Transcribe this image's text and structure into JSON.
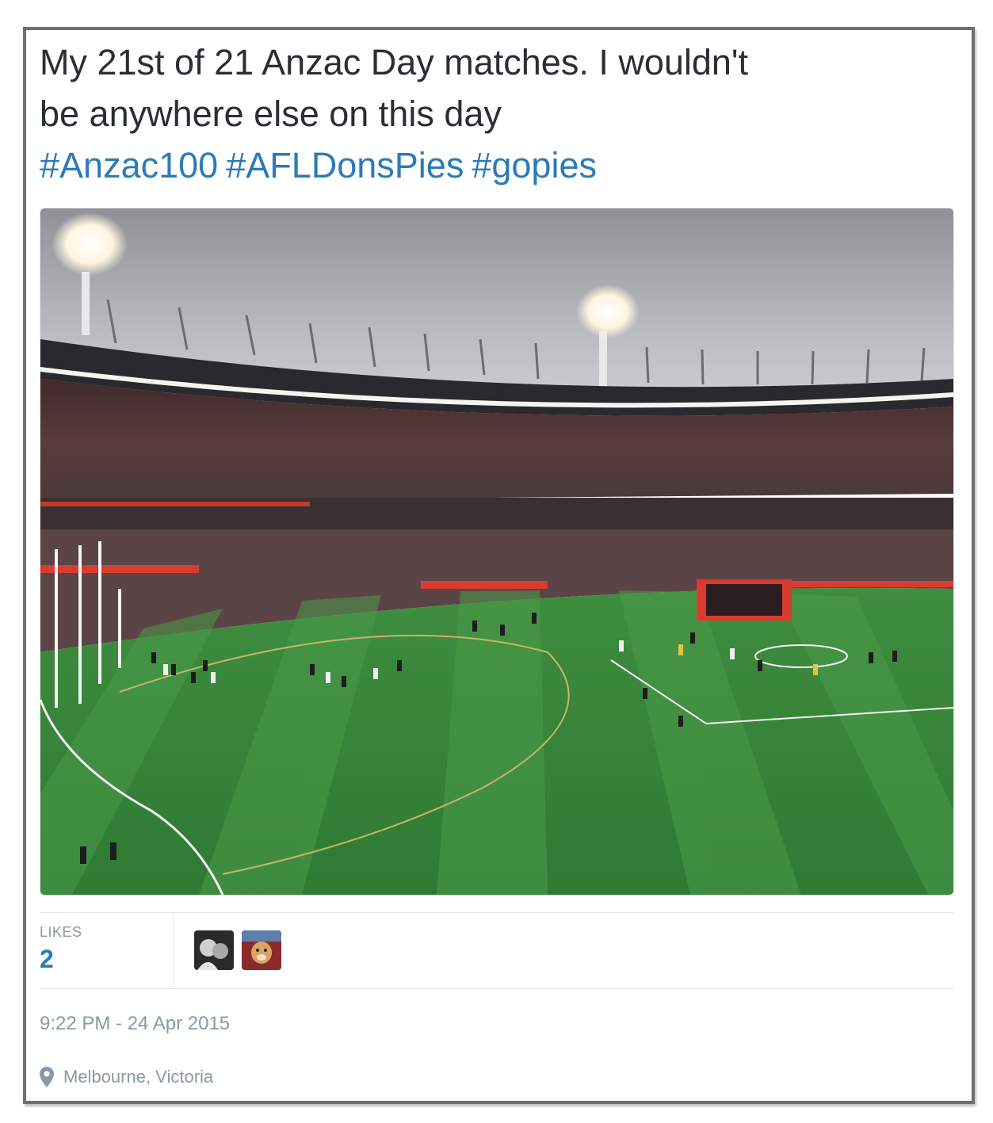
{
  "tweet": {
    "text_line1": "My 21st of 21 Anzac Day matches. I wouldn't",
    "text_line2": "be anywhere else on this day",
    "hashtags": [
      "#Anzac100",
      "#AFLDonsPies",
      "#gopies"
    ]
  },
  "photo": {
    "description_icon": "stadium-photo"
  },
  "stats": {
    "likes_label": "LIKES",
    "likes_count": "2"
  },
  "meta": {
    "timestamp": "9:22 PM - 24 Apr 2015",
    "location": "Melbourne, Victoria",
    "location_icon": "map-pin-icon"
  },
  "colors": {
    "text": "#292f33",
    "link": "#2b7bb9",
    "muted": "#8899a6",
    "border": "#e1e8ed",
    "frame": "#6f6f6f"
  }
}
